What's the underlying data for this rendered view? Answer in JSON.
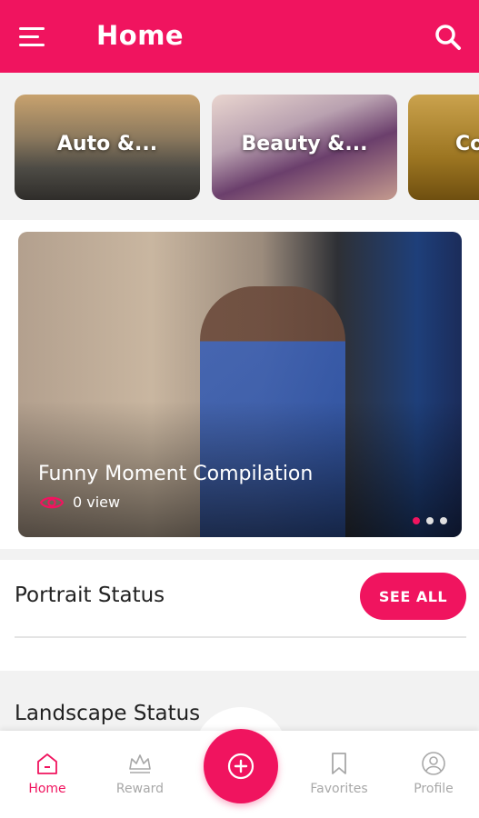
{
  "app_bar": {
    "title": "Home"
  },
  "categories": [
    {
      "label": "Auto &..."
    },
    {
      "label": "Beauty &..."
    },
    {
      "label": "Co"
    }
  ],
  "featured": {
    "title": "Funny Moment Compilation",
    "views": "0 view",
    "slide_count": 3,
    "active_slide": 1
  },
  "portrait_section": {
    "title": "Portrait Status",
    "see_all_label": "SEE ALL"
  },
  "landscape_section": {
    "title": "Landscape Status"
  },
  "bottom_nav": {
    "items": [
      {
        "label": "Home",
        "icon": "home-icon",
        "active": true
      },
      {
        "label": "Reward",
        "icon": "crown-icon",
        "active": false
      },
      {
        "label": "Favorites",
        "icon": "bookmark-icon",
        "active": false
      },
      {
        "label": "Profile",
        "icon": "profile-icon",
        "active": false
      }
    ],
    "fab_icon": "add-circle-icon"
  },
  "colors": {
    "accent": "#f0145f",
    "inactive": "#a8a8a8"
  }
}
